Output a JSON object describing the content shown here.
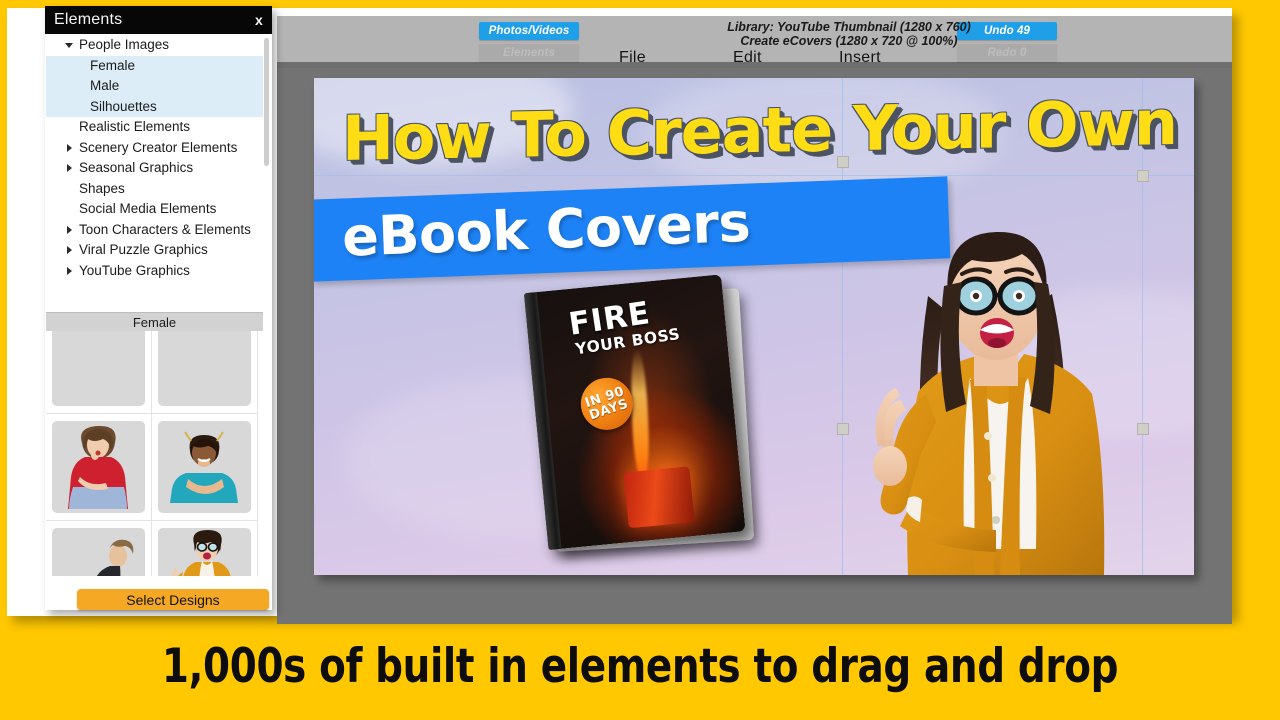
{
  "window": {
    "toolbar": {
      "photos_videos_label": "Photos/Videos",
      "elements_label": "Elements",
      "undo_label": "Undo 49",
      "redo_label": "Redo 0",
      "library_line1": "Library: YouTube Thumbnail (1280 x 760)",
      "library_line2": "Create eCovers (1280 x 720 @ 100%)",
      "menu": {
        "file": "File",
        "edit": "Edit",
        "insert": "Insert"
      },
      "accent_blue": "#1f9fe8",
      "bar_bg": "#b4b4b4"
    }
  },
  "panel": {
    "title": "Elements",
    "close_label": "x",
    "tree": [
      {
        "label": "People Images",
        "caret": "open",
        "level": 0,
        "selected": false
      },
      {
        "label": "Female",
        "caret": "none",
        "level": 1,
        "selected": true
      },
      {
        "label": "Male",
        "caret": "none",
        "level": 1,
        "selected": true
      },
      {
        "label": "Silhouettes",
        "caret": "none",
        "level": 1,
        "selected": true
      },
      {
        "label": "Realistic Elements",
        "caret": "none",
        "level": 0,
        "selected": false
      },
      {
        "label": "Scenery Creator Elements",
        "caret": "closed",
        "level": 0,
        "selected": false
      },
      {
        "label": "Seasonal Graphics",
        "caret": "closed",
        "level": 0,
        "selected": false
      },
      {
        "label": "Shapes",
        "caret": "none",
        "level": 0,
        "selected": false
      },
      {
        "label": "Social Media Elements",
        "caret": "none",
        "level": 0,
        "selected": false
      },
      {
        "label": "Toon Characters & Elements",
        "caret": "closed",
        "level": 0,
        "selected": false
      },
      {
        "label": "Viral Puzzle Graphics",
        "caret": "closed",
        "level": 0,
        "selected": false
      },
      {
        "label": "YouTube Graphics",
        "caret": "closed",
        "level": 0,
        "selected": false
      }
    ],
    "category_header": "Female",
    "thumbnails": [
      {
        "name": "woman-red-shirt-thinking"
      },
      {
        "name": "woman-teal-shirt-leaning"
      },
      {
        "name": "woman-sitting-jeans"
      },
      {
        "name": "woman-yellow-cardigan-pointing"
      }
    ],
    "select_designs_label": "Select Designs",
    "button_color": "#F5A823"
  },
  "canvas": {
    "headline": "How To Create Your Own",
    "banner_text": "eBook Covers",
    "headline_color": "#FFDD15",
    "banner_color": "#1D82F5",
    "book": {
      "title": "FIRE",
      "subtitle": "YOUR BOSS",
      "badge_line1": "IN 90",
      "badge_line2": "DAYS"
    },
    "person": {
      "name": "woman-yellow-cardigan-pointing"
    }
  },
  "caption": {
    "text": "1,000s of built in elements to drag and drop",
    "background": "#FFC800"
  }
}
